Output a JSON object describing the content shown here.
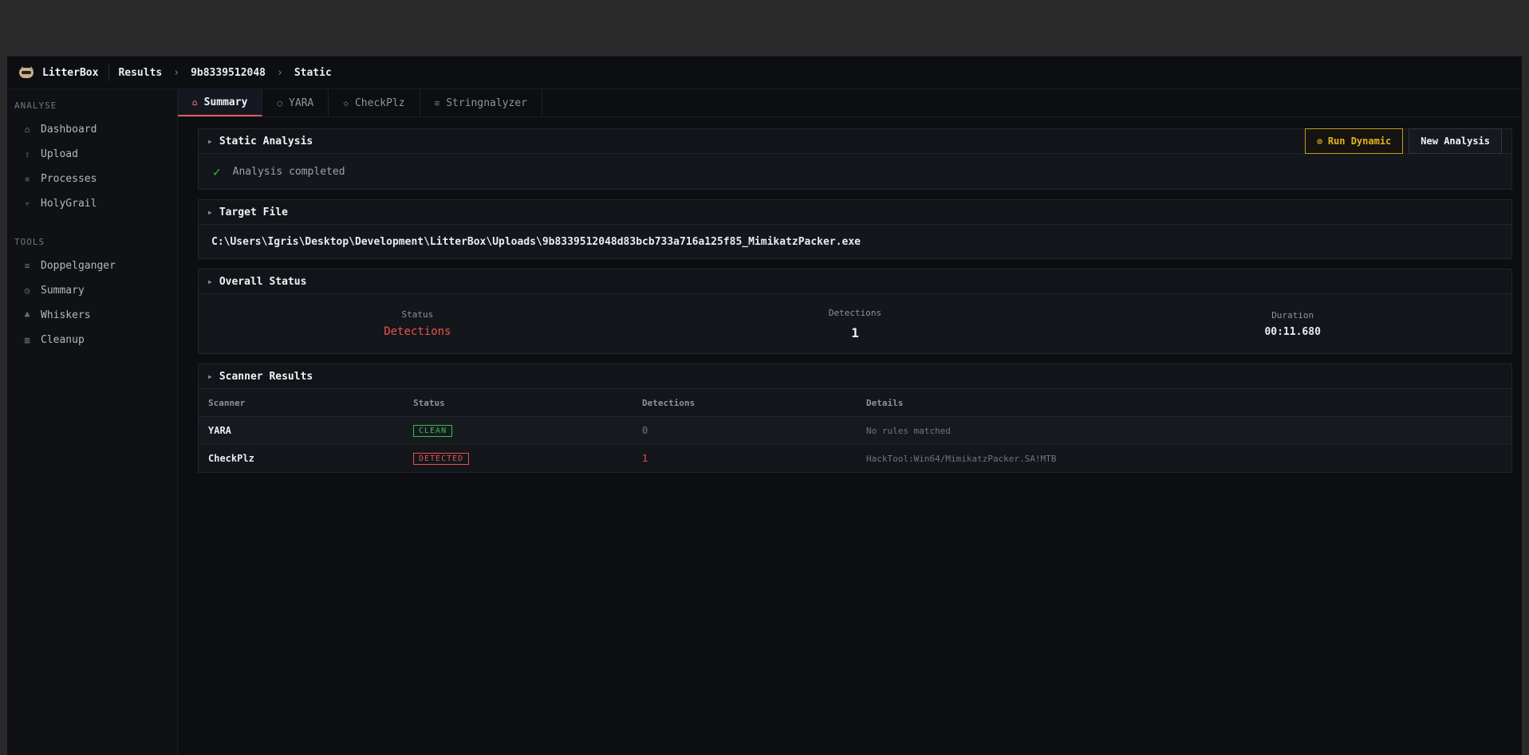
{
  "app": {
    "name": "LitterBox"
  },
  "breadcrumb": [
    "Results",
    "9b8339512048",
    "Static"
  ],
  "sidebar": {
    "sections": [
      {
        "label": "ANALYSE",
        "items": [
          {
            "label": "Dashboard",
            "icon": "home-icon"
          },
          {
            "label": "Upload",
            "icon": "upload-icon"
          },
          {
            "label": "Processes",
            "icon": "gear-icon"
          },
          {
            "label": "HolyGrail",
            "icon": "grail-icon"
          }
        ]
      },
      {
        "label": "TOOLS",
        "items": [
          {
            "label": "Doppelganger",
            "icon": "list-icon"
          },
          {
            "label": "Summary",
            "icon": "clock-icon"
          },
          {
            "label": "Whiskers",
            "icon": "paw-icon"
          },
          {
            "label": "Cleanup",
            "icon": "trash-icon"
          }
        ]
      }
    ]
  },
  "tabs": [
    {
      "label": "Summary",
      "icon": "home-icon",
      "active": true
    },
    {
      "label": "YARA",
      "icon": "search-icon"
    },
    {
      "label": "CheckPlz",
      "icon": "shield-icon"
    },
    {
      "label": "Stringnalyzer",
      "icon": "text-lines-icon"
    }
  ],
  "static_analysis": {
    "title": "Static Analysis",
    "status": "Analysis completed",
    "run_dynamic_label": "Run Dynamic",
    "new_analysis_label": "New Analysis"
  },
  "target_file": {
    "title": "Target File",
    "path": "C:\\Users\\Igris\\Desktop\\Development\\LitterBox\\Uploads\\9b8339512048d83bcb733a716a125f85_MimikatzPacker.exe"
  },
  "overall_status": {
    "title": "Overall Status",
    "status_label": "Status",
    "status_value": "Detections",
    "detections_label": "Detections",
    "detections_value": "1",
    "duration_label": "Duration",
    "duration_value": "00:11.680"
  },
  "scanner_results": {
    "title": "Scanner Results",
    "columns": [
      "Scanner",
      "Status",
      "Detections",
      "Details"
    ],
    "rows": [
      {
        "scanner": "YARA",
        "status": "CLEAN",
        "detections": "0",
        "details": "No rules matched"
      },
      {
        "scanner": "CheckPlz",
        "status": "DETECTED",
        "detections": "1",
        "details": "HackTool:Win64/MimikatzPacker.SA!MTB"
      }
    ]
  },
  "colors": {
    "accent_red": "#e5534b",
    "accent_green": "#3fb950",
    "warn_yellow": "#e6b422"
  }
}
